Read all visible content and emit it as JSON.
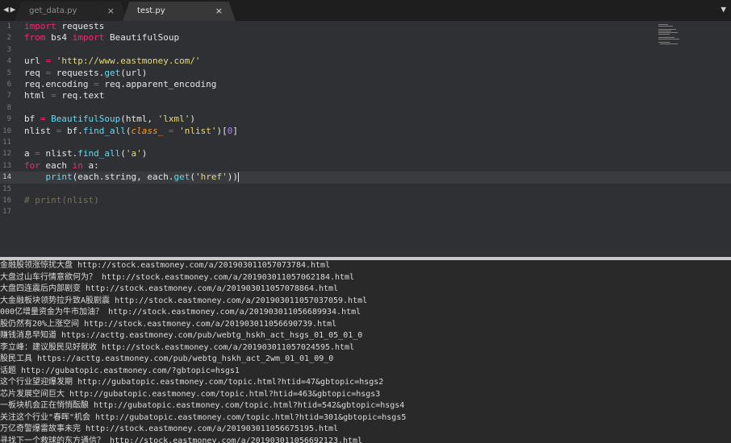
{
  "tabs": [
    {
      "label": "get_data.py",
      "close": "×",
      "active": false
    },
    {
      "label": "test.py",
      "close": "×",
      "active": true
    }
  ],
  "nav_arrows": "◀▶",
  "menu_caret": "▼",
  "line_numbers": [
    "1",
    "2",
    "3",
    "4",
    "5",
    "6",
    "7",
    "8",
    "9",
    "10",
    "11",
    "12",
    "13",
    "14",
    "15",
    "16",
    "17"
  ],
  "code": {
    "l1_kw": "import",
    "l1_rest": " requests",
    "l2_kw1": "from",
    "l2_mid": " bs4 ",
    "l2_kw2": "import",
    "l2_rest": " BeautifulSoup",
    "l4_a": "url ",
    "l4_op": "=",
    "l4_sp": " ",
    "l4_str": "'http://www.eastmoney.com/'",
    "l5_a": "req ",
    "l5_op": "=",
    "l5_b": " requests.",
    "l5_fn": "get",
    "l5_c": "(url)",
    "l6_a": "req.encoding ",
    "l6_op": "=",
    "l6_b": " req.apparent_encoding",
    "l7_a": "html ",
    "l7_op": "=",
    "l7_b": " req.text",
    "l9_a": "bf ",
    "l9_op": "=",
    "l9_sp": " ",
    "l9_fn": "BeautifulSoup",
    "l9_b": "(html, ",
    "l9_str": "'lxml'",
    "l9_c": ")",
    "l10_a": "nlist ",
    "l10_op": "=",
    "l10_b": " bf.",
    "l10_fn": "find_all",
    "l10_c": "(",
    "l10_pa": "class_",
    "l10_d": " ",
    "l10_op2": "=",
    "l10_e": " ",
    "l10_str": "'nlist'",
    "l10_f": ")[",
    "l10_nu": "0",
    "l10_g": "]",
    "l12_a": "a ",
    "l12_op": "=",
    "l12_b": " nlist.",
    "l12_fn": "find_all",
    "l12_c": "(",
    "l12_str": "'a'",
    "l12_d": ")",
    "l13_kw1": "for",
    "l13_a": " each ",
    "l13_kw2": "in",
    "l13_b": " a:",
    "l14_indent": "    ",
    "l14_fn": "print",
    "l14_a": "(each.string, each.",
    "l14_fn2": "get",
    "l14_b": "(",
    "l14_str": "'href'",
    "l14_c": "))",
    "l16_cm": "# print(nlist)"
  },
  "console_lines": [
    "金融股领涨惊扰大盘 http://stock.eastmoney.com/a/201903011057073784.html",
    "大盘过山车行情意欲何为？ http://stock.eastmoney.com/a/201903011057062184.html",
    "大盘四连震后内部剧变 http://stock.eastmoney.com/a/201903011057078864.html",
    "大金融板块领势拉升致A股剧震 http://stock.eastmoney.com/a/201903011057037059.html",
    "000亿增量资金为牛市加油？ http://stock.eastmoney.com/a/201903011056689934.html",
    "股仍然有20%上涨空间 http://stock.eastmoney.com/a/201903011056690739.html",
    "赚钱消息早知道 https://acttg.eastmoney.com/pub/webtg_hskh_act_hsgs_01_05_01_0",
    "李立峰：建议股民见好就收 http://stock.eastmoney.com/a/201903011057024595.html",
    "股民工具 https://acttg.eastmoney.com/pub/webtg_hskh_act_2wm_01_01_09_0",
    "话题 http://gubatopic.eastmoney.com/?gbtopic=hsgs1",
    "这个行业望迎爆发期 http://gubatopic.eastmoney.com/topic.html?htid=47&gbtopic=hsgs2",
    "芯片发展空间巨大 http://gubatopic.eastmoney.com/topic.html?htid=463&gbtopic=hsgs3",
    "一板块机会正在悄悄酝酿 http://gubatopic.eastmoney.com/topic.html?htid=542&gbtopic=hsgs4",
    "关注这个行业\"春晖\"机会 http://gubatopic.eastmoney.com/topic.html?htid=301&gbtopic=hsgs5",
    "万亿奇警爆雷故事未完 http://stock.eastmoney.com/a/201903011056675195.html",
    "寻找下一个救球的东方通信？ http://stock.eastmoney.com/a/201903011056692123.html"
  ]
}
